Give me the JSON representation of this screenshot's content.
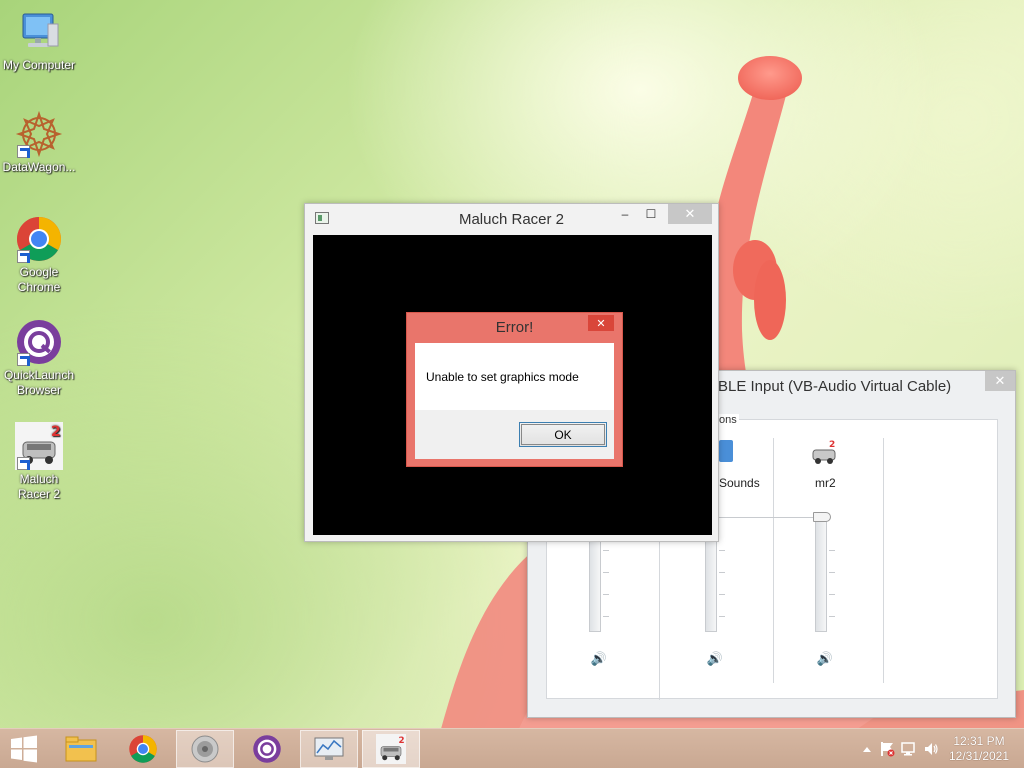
{
  "desktop": {
    "icons": [
      {
        "label": "My Computer"
      },
      {
        "label": "DataWagon..."
      },
      {
        "label": "Google Chrome"
      },
      {
        "label": "QuickLaunch Browser"
      },
      {
        "label": "Maluch Racer 2"
      }
    ]
  },
  "game_window": {
    "title": "Maluch Racer 2",
    "minimize_glyph": "–",
    "maximize_glyph": "☐",
    "close_glyph": "✕"
  },
  "error_dialog": {
    "title": "Error!",
    "close_glyph": "✕",
    "message": "Unable to set graphics mode",
    "ok_label": "OK"
  },
  "volume_mixer": {
    "title": "BLE Input (VB-Audio Virtual Cable)",
    "close_glyph": "✕",
    "section_label": "ons",
    "channels": [
      {
        "label": ""
      },
      {
        "label": "Sounds"
      },
      {
        "label": "mr2"
      }
    ],
    "speaker_glyph": "🔊"
  },
  "taskbar": {
    "items": [
      "start",
      "file-explorer",
      "chrome",
      "sound",
      "quicklaunch",
      "monitor",
      "maluch-racer"
    ],
    "active_index": 6,
    "clock_time": "12:31 PM",
    "clock_date": "12/31/2021"
  },
  "colors": {
    "error_accent": "#e9756b",
    "taskbar": "#d0b09a",
    "chrome_red": "#db4437",
    "chrome_green": "#0f9d58",
    "chrome_yellow": "#f4b400",
    "chrome_blue": "#4285f4",
    "quicklaunch_purple": "#7a3e9d"
  }
}
